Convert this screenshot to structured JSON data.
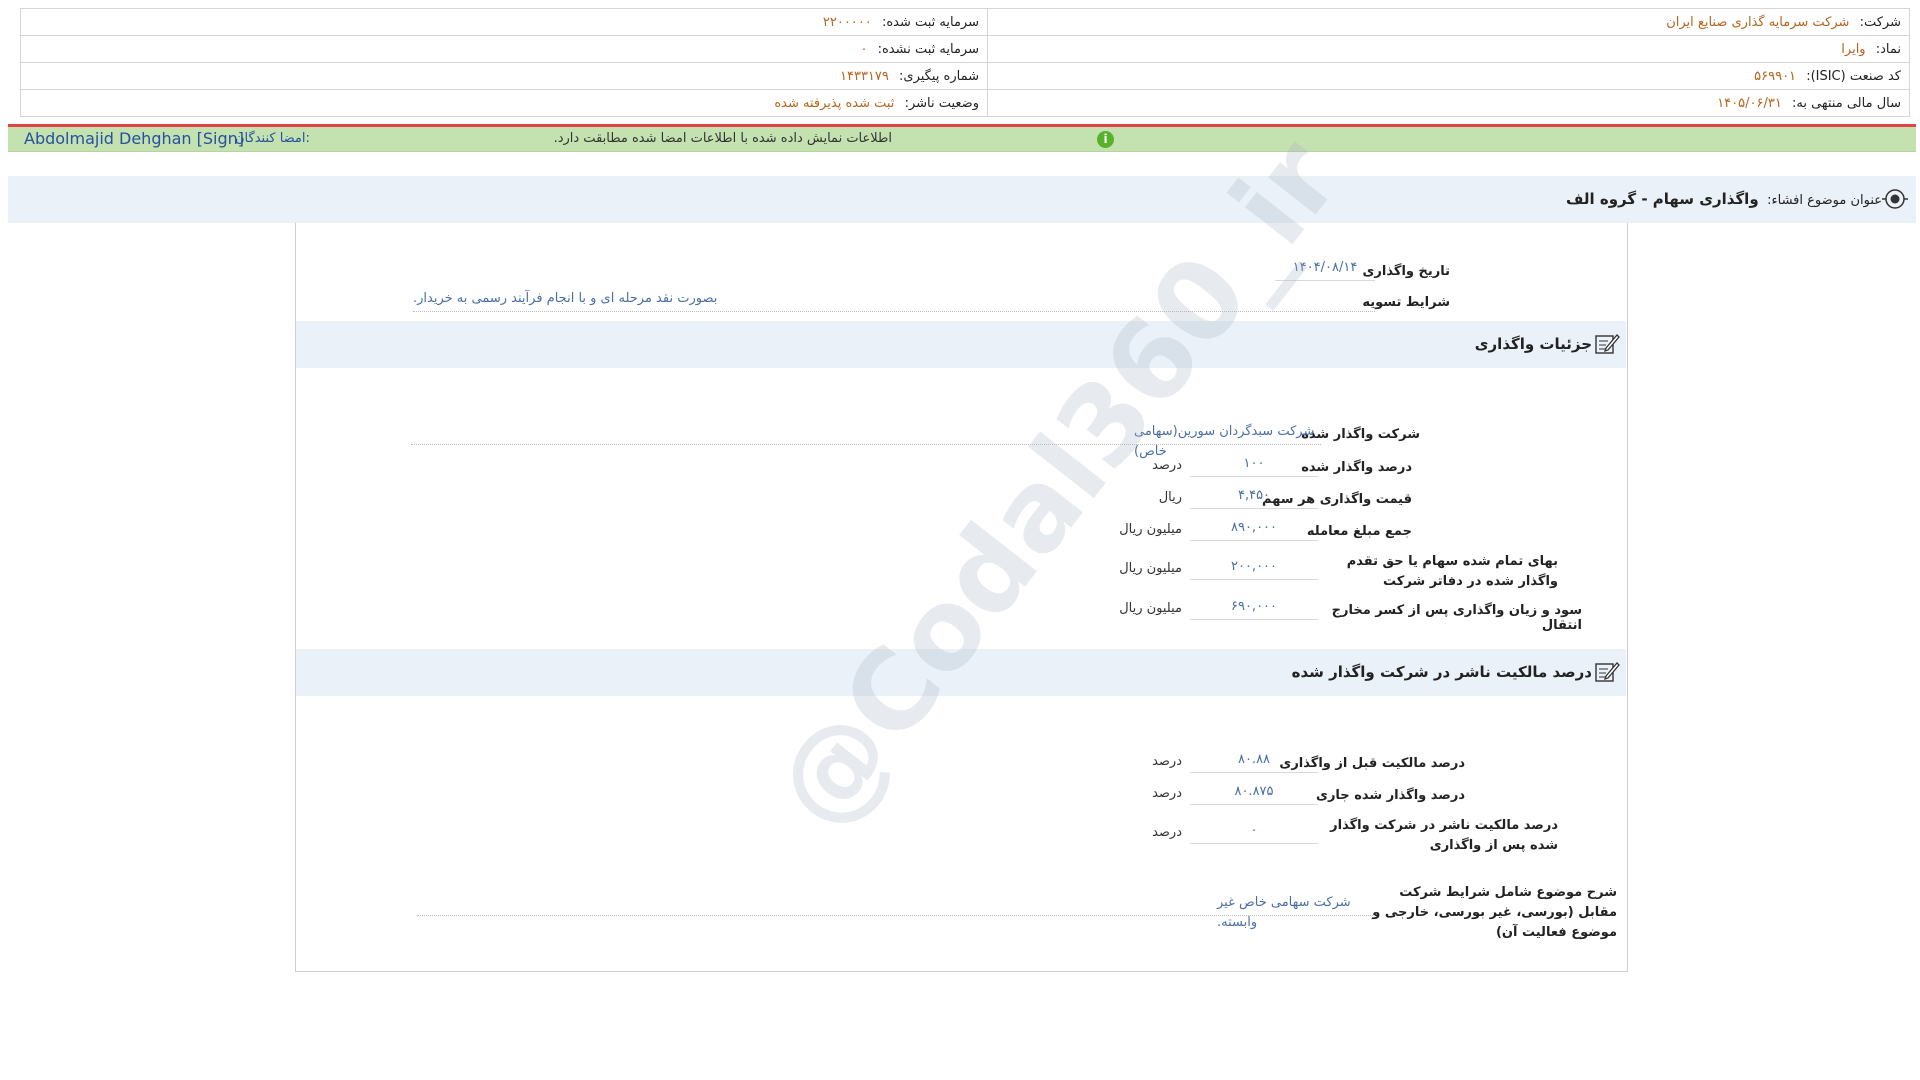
{
  "header": {
    "company_label": "شرکت:",
    "company_value": "شرکت سرمایه گذاری صنایع ایران",
    "symbol_label": "نماد:",
    "symbol_value": "وایرا",
    "isic_label": "کد صنعت (ISIC):",
    "isic_value": "۵۶۹۹۰۱",
    "fiscal_label": "سال مالی منتهی به:",
    "fiscal_value": "۱۴۰۵/۰۶/۳۱",
    "registered_capital_label": "سرمایه ثبت شده:",
    "registered_capital_value": "۲۲۰۰۰۰۰",
    "unregistered_capital_label": "سرمایه ثبت نشده:",
    "unregistered_capital_value": "۰",
    "tracking_label": "شماره پیگیری:",
    "tracking_value": "۱۴۳۳۱۷۹",
    "publisher_status_label": "وضعیت ناشر:",
    "publisher_status_value": "ثبت شده پذیرفته شده"
  },
  "signature": {
    "signers_label": "امضا کنندگان:",
    "signer_name": "Abdolmajid Dehghan [Sign]",
    "verify_message": "اطلاعات نمایش داده شده با اطلاعات امضا شده مطابقت دارد.",
    "info_icon_glyph": "i"
  },
  "subject": {
    "label": "عنوان موضوع افشاء:",
    "value": "واگذاری سهام - گروه الف"
  },
  "top_fields": {
    "date_label": "تاریخ واگذاری",
    "date_value": "۱۴۰۴/۰۸/۱۴",
    "settlement_label": "شرایط تسویه",
    "settlement_value": "بصورت نقد مرحله ای و با انجام فرآیند رسمی به خریدار."
  },
  "details": {
    "title": "جزئیات واگذاری",
    "company_label": "شرکت واگذار شده",
    "company_value": "شرکت سبدگردان سورین(سهامی خاص)",
    "rows": [
      {
        "label": "درصد واگذار شده",
        "value": "۱۰۰",
        "unit": "درصد"
      },
      {
        "label": "قیمت واگذاری هر سهم",
        "value": "۴,۴۵۰",
        "unit": "ریال"
      },
      {
        "label": "جمع مبلغ معامله",
        "value": "۸۹۰,۰۰۰",
        "unit": "میلیون ریال"
      },
      {
        "label": "بهای تمام شده سهام یا حق تقدم واگذار شده در دفاتر شرکت",
        "value": "۲۰۰,۰۰۰",
        "unit": "میلیون ریال"
      },
      {
        "label": "سود و زیان واگذاری پس از کسر مخارج انتقال",
        "value": "۶۹۰,۰۰۰",
        "unit": "میلیون ریال"
      }
    ]
  },
  "ownership": {
    "title": "درصد مالکیت ناشر در شرکت واگذار شده",
    "rows": [
      {
        "label": "درصد مالکیت قبل از واگذاری",
        "value": "۸۰.۸۸",
        "unit": "درصد"
      },
      {
        "label": "درصد واگذار شده جاری",
        "value": "۸۰.۸۷۵",
        "unit": "درصد"
      },
      {
        "label": "درصد مالکیت ناشر در شرکت واگذار شده پس از واگذاری",
        "value": "۰",
        "unit": "درصد"
      }
    ],
    "description_label": "شرح موضوع شامل شرایط شرکت مقابل (بورسی، غیر بورسی، خارجی و موضوع فعالیت آن)",
    "description_value": "شرکت سهامی خاص غیر وابسته."
  },
  "watermark": "@Codal360_ir",
  "colors": {
    "accent_red": "#e04444",
    "sign_bar_green": "#c4e1b0",
    "section_bg": "#eaf1f8",
    "value_orange": "#b5651d",
    "value_blue": "#4a6fa5"
  }
}
